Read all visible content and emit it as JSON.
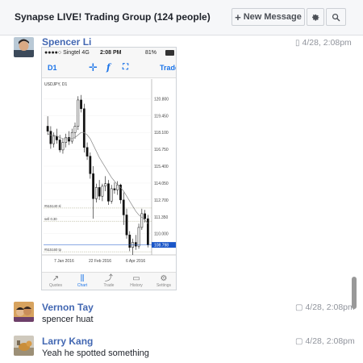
{
  "header": {
    "title": "Synapse LIVE! Trading Group  (124 people)",
    "new_message_label": "New Message"
  },
  "messages": [
    {
      "sender": "Spencer Li",
      "time": "4/28, 2:08pm",
      "text": ""
    },
    {
      "sender": "Vernon Tay",
      "time": "4/28, 2:08pm",
      "text": "spencer huat"
    },
    {
      "sender": "Larry Kang",
      "time": "4/28, 2:08pm",
      "text": "Yeah he spotted something"
    }
  ],
  "attachment": {
    "status_left": "●●●●○ Singtel  4G",
    "status_time": "2:08 PM",
    "status_right": "81%",
    "period": "D1",
    "trade_label": "Trade",
    "chart_data": {
      "type": "candlestick",
      "title": "USDJPY, D1",
      "y_ticks": [
        "120.800",
        "119.450",
        "118.100",
        "116.750",
        "115.400",
        "114.050",
        "112.700",
        "111.350",
        "110.000"
      ],
      "x_ticks": [
        "7 Jan 2016",
        "22 Feb 2016",
        "6 Apr 2016"
      ],
      "current_price_label": "108.798",
      "level_labels": [
        "#515140 sl",
        "sell 0.30",
        "#515160 tp"
      ],
      "ylim": [
        108.3,
        121.6
      ],
      "candles": [
        [
          118.6,
          119.4,
          117.9,
          118.2
        ],
        [
          118.2,
          118.6,
          116.8,
          117.2
        ],
        [
          117.2,
          118.1,
          116.9,
          117.8
        ],
        [
          117.8,
          118.4,
          117.2,
          117.5
        ],
        [
          117.5,
          117.9,
          116.5,
          116.7
        ],
        [
          116.7,
          117.6,
          116.4,
          117.3
        ],
        [
          117.3,
          118.0,
          116.9,
          117.7
        ],
        [
          117.7,
          118.2,
          117.1,
          117.4
        ],
        [
          117.4,
          118.4,
          117.2,
          118.1
        ],
        [
          118.1,
          118.9,
          117.6,
          118.6
        ],
        [
          118.6,
          121.0,
          118.3,
          120.7
        ],
        [
          120.7,
          121.1,
          119.7,
          120.0
        ],
        [
          120.0,
          120.4,
          116.5,
          116.9
        ],
        [
          116.9,
          117.3,
          115.9,
          116.2
        ],
        [
          116.2,
          116.5,
          114.4,
          114.8
        ],
        [
          114.8,
          115.4,
          111.2,
          112.8
        ],
        [
          112.8,
          114.0,
          112.5,
          113.7
        ],
        [
          113.7,
          114.3,
          112.7,
          113.0
        ],
        [
          113.0,
          114.0,
          112.6,
          113.8
        ],
        [
          113.8,
          114.6,
          113.4,
          114.0
        ],
        [
          114.0,
          114.3,
          112.3,
          112.6
        ],
        [
          112.6,
          113.9,
          112.4,
          113.6
        ],
        [
          113.6,
          114.1,
          113.2,
          113.5
        ],
        [
          113.5,
          114.2,
          113.1,
          113.9
        ],
        [
          113.9,
          114.0,
          112.4,
          112.7
        ],
        [
          112.7,
          113.3,
          110.7,
          111.5
        ],
        [
          111.5,
          112.0,
          109.6,
          109.9
        ],
        [
          109.9,
          110.2,
          108.6,
          108.9
        ],
        [
          108.9,
          109.6,
          108.3,
          109.3
        ],
        [
          109.3,
          109.9,
          108.7,
          109.0
        ],
        [
          109.0,
          110.8,
          108.8,
          110.5
        ],
        [
          110.5,
          112.0,
          110.3,
          111.6
        ],
        [
          111.6,
          111.9,
          110.9,
          111.2
        ],
        [
          111.2,
          111.5,
          108.9,
          109.1
        ]
      ],
      "ma": [
        118.0,
        117.9,
        117.9,
        117.8,
        117.7,
        117.6,
        117.6,
        117.6,
        117.6,
        117.7,
        117.9,
        118.1,
        118.1,
        117.9,
        117.6,
        117.1,
        116.6,
        116.1,
        115.7,
        115.3,
        114.9,
        114.5,
        114.2,
        113.9,
        113.7,
        113.4,
        113.0,
        112.6,
        112.2,
        111.8,
        111.5,
        111.3,
        111.1,
        110.8
      ]
    },
    "tabs": [
      {
        "label": "Quotes",
        "icon": "quotes-icon"
      },
      {
        "label": "Chart",
        "icon": "candlestick-icon"
      },
      {
        "label": "Trade",
        "icon": "trend-icon"
      },
      {
        "label": "History",
        "icon": "inbox-icon"
      },
      {
        "label": "Settings",
        "icon": "gear-icon"
      }
    ]
  },
  "colors": {
    "link": "#4267b2",
    "header_bg": "#f6f7f9",
    "chart_accent": "#1a73e8",
    "price_marker": "#1a56c8"
  }
}
